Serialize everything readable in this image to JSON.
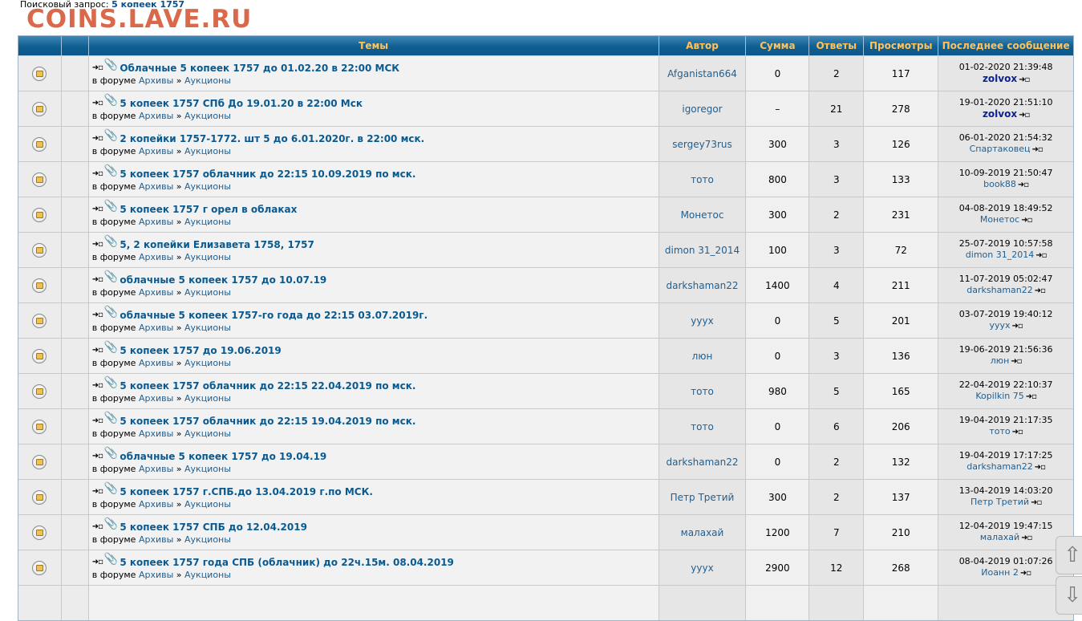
{
  "search": {
    "label": "Поисковый запрос:",
    "query": "5 копеек 1757"
  },
  "watermark": "COINS.LAVE.RU",
  "headers": {
    "topics": "Темы",
    "author": "Автор",
    "sum": "Сумма",
    "replies": "Ответы",
    "views": "Просмотры",
    "last": "Последнее сообщение"
  },
  "forum_prefix": "в форуме",
  "rows": [
    {
      "title": "Облачные 5 копеек 1757 до 01.02.20 в 22:00 МСК",
      "forum": "Архивы",
      "subforum": "Аукционы",
      "author": "Afganistan664",
      "sum": "0",
      "replies": "2",
      "views": "117",
      "last_time": "01-02-2020 21:39:48",
      "last_user": "zolvox",
      "last_bold": true
    },
    {
      "title": "5 копеек 1757 СПб До 19.01.20 в 22:00 Мск",
      "forum": "Архивы",
      "subforum": "Аукционы",
      "author": "igoregor",
      "sum": "–",
      "replies": "21",
      "views": "278",
      "last_time": "19-01-2020 21:51:10",
      "last_user": "zolvox",
      "last_bold": true
    },
    {
      "title": "2 копейки 1757-1772. шт 5 до 6.01.2020г. в 22:00 мск.",
      "forum": "Архивы",
      "subforum": "Аукционы",
      "author": "sergey73rus",
      "sum": "300",
      "replies": "3",
      "views": "126",
      "last_time": "06-01-2020 21:54:32",
      "last_user": "Спартаковец",
      "last_bold": false
    },
    {
      "title": "5 копеек 1757 облачник до 22:15 10.09.2019 по мск.",
      "forum": "Архивы",
      "subforum": "Аукционы",
      "author": "тото",
      "sum": "800",
      "replies": "3",
      "views": "133",
      "last_time": "10-09-2019 21:50:47",
      "last_user": "book88",
      "last_bold": false
    },
    {
      "title": "5 копеек 1757 г орел в облаках",
      "forum": "Архивы",
      "subforum": "Аукционы",
      "author": "Монетос",
      "sum": "300",
      "replies": "2",
      "views": "231",
      "last_time": "04-08-2019 18:49:52",
      "last_user": "Монетос",
      "last_bold": false
    },
    {
      "title": "5, 2 копейки Елизавета 1758, 1757",
      "forum": "Архивы",
      "subforum": "Аукционы",
      "author": "dimon 31_2014",
      "sum": "100",
      "replies": "3",
      "views": "72",
      "last_time": "25-07-2019 10:57:58",
      "last_user": "dimon 31_2014",
      "last_bold": false
    },
    {
      "title": "облачные 5 копеек 1757 до 10.07.19",
      "forum": "Архивы",
      "subforum": "Аукционы",
      "author": "darkshaman22",
      "sum": "1400",
      "replies": "4",
      "views": "211",
      "last_time": "11-07-2019 05:02:47",
      "last_user": "darkshaman22",
      "last_bold": false
    },
    {
      "title": "облачные 5 копеек 1757-го года до 22:15 03.07.2019г.",
      "forum": "Архивы",
      "subforum": "Аукционы",
      "author": "yyyx",
      "sum": "0",
      "replies": "5",
      "views": "201",
      "last_time": "03-07-2019 19:40:12",
      "last_user": "yyyx",
      "last_bold": false
    },
    {
      "title": "5 копеек 1757 до 19.06.2019",
      "forum": "Архивы",
      "subforum": "Аукционы",
      "author": "люн",
      "sum": "0",
      "replies": "3",
      "views": "136",
      "last_time": "19-06-2019 21:56:36",
      "last_user": "люн",
      "last_bold": false
    },
    {
      "title": "5 копеек 1757 облачник до 22:15 22.04.2019 по мск.",
      "forum": "Архивы",
      "subforum": "Аукционы",
      "author": "тото",
      "sum": "980",
      "replies": "5",
      "views": "165",
      "last_time": "22-04-2019 22:10:37",
      "last_user": "Kopilkin 75",
      "last_bold": false
    },
    {
      "title": "5 копеек 1757 облачник до 22:15 19.04.2019 по мск.",
      "forum": "Архивы",
      "subforum": "Аукционы",
      "author": "тото",
      "sum": "0",
      "replies": "6",
      "views": "206",
      "last_time": "19-04-2019 21:17:35",
      "last_user": "тото",
      "last_bold": false
    },
    {
      "title": "облачные 5 копеек 1757 до 19.04.19",
      "forum": "Архивы",
      "subforum": "Аукционы",
      "author": "darkshaman22",
      "sum": "0",
      "replies": "2",
      "views": "132",
      "last_time": "19-04-2019 17:17:25",
      "last_user": "darkshaman22",
      "last_bold": false
    },
    {
      "title": "5 копеек 1757 г.СПБ.до 13.04.2019 г.по МСК.",
      "forum": "Архивы",
      "subforum": "Аукционы",
      "author": "Петр Третий",
      "sum": "300",
      "replies": "2",
      "views": "137",
      "last_time": "13-04-2019 14:03:20",
      "last_user": "Петр Третий",
      "last_bold": false
    },
    {
      "title": "5 копеек 1757 СПБ до 12.04.2019",
      "forum": "Архивы",
      "subforum": "Аукционы",
      "author": "малахай",
      "sum": "1200",
      "replies": "7",
      "views": "210",
      "last_time": "12-04-2019 19:47:15",
      "last_user": "малахай",
      "last_bold": false
    },
    {
      "title": "5 копеек 1757 года СПБ (облачник) до 22ч.15м. 08.04.2019",
      "forum": "Архивы",
      "subforum": "Аукционы",
      "author": "yyyx",
      "sum": "2900",
      "replies": "12",
      "views": "268",
      "last_time": "08-04-2019 01:07:26",
      "last_user": "Иоанн 2",
      "last_bold": false
    }
  ],
  "icons": {
    "topic": "topic-status-icon",
    "goto": "goto-new-post-icon",
    "attachment": "paperclip-icon",
    "last_post": "goto-last-post-icon",
    "scroll_up": "arrow-up-icon",
    "scroll_down": "arrow-down-icon"
  }
}
